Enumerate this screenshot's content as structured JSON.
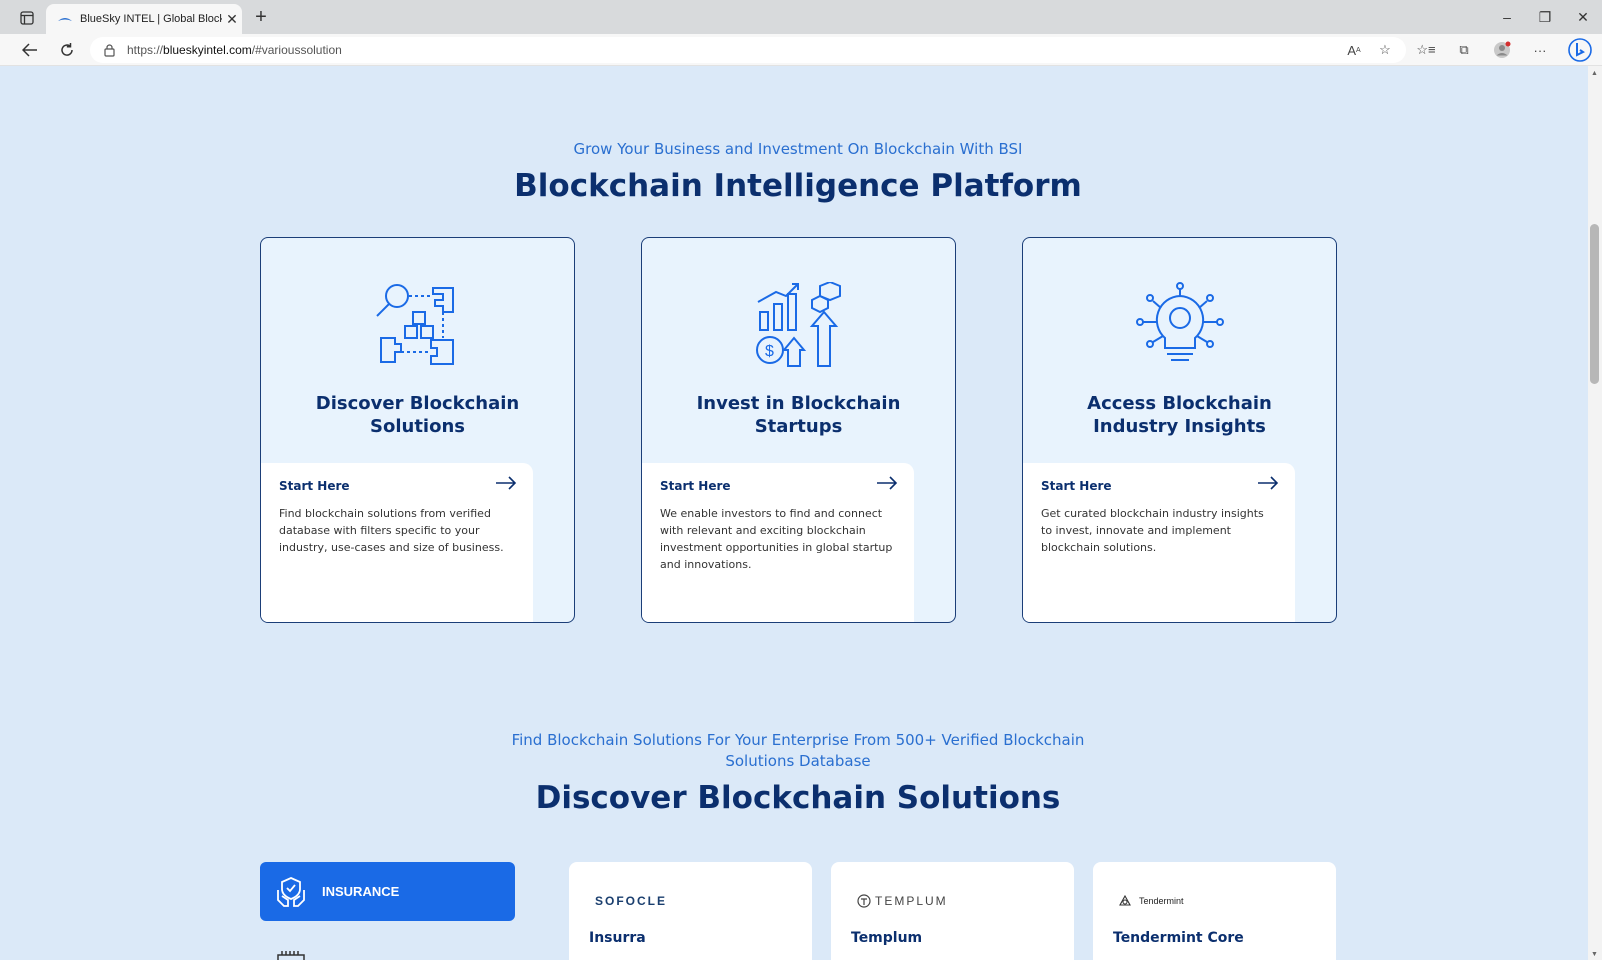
{
  "browser": {
    "tab_title": "BlueSky INTEL | Global Blockchai",
    "url_prefix": "https://",
    "url_host": "blueskyintel.com",
    "url_path": "/#varioussolution"
  },
  "section1": {
    "subtitle": "Grow Your Business and Investment On Blockchain With BSI",
    "heading": "Blockchain Intelligence Platform",
    "cards": [
      {
        "title": "Discover Blockchain Solutions",
        "link_label": "Start Here",
        "description": "Find blockchain solutions from verified database with filters specific to your industry, use-cases and size of business.",
        "icon": "puzzle-search-icon"
      },
      {
        "title": "Invest in Blockchain Startups",
        "link_label": "Start Here",
        "description": "We enable investors to find and connect with relevant and exciting blockchain investment opportunities in global startup and innovations.",
        "icon": "growth-chart-icon"
      },
      {
        "title": "Access Blockchain Industry Insights",
        "link_label": "Start Here",
        "description": "Get curated blockchain industry insights to invest, innovate and implement blockchain solutions.",
        "icon": "lightbulb-network-icon"
      }
    ]
  },
  "section2": {
    "subtitle_line1": "Find Blockchain Solutions For Your Enterprise From 500+ Verified Blockchain",
    "subtitle_line2": "Solutions Database",
    "heading": "Discover Blockchain Solutions",
    "active_category": "INSURANCE",
    "solutions": [
      {
        "logo_text": "SOFOCLE",
        "name": "Insurra"
      },
      {
        "logo_text": "TEMPLUM",
        "name": "Templum"
      },
      {
        "logo_text": "Tendermint",
        "name": "Tendermint Core"
      }
    ]
  },
  "colors": {
    "page_bg": "#dbe9f8",
    "accent": "#1a6ae6",
    "heading": "#0b2f6e",
    "subtitle": "#2a6fd0"
  }
}
